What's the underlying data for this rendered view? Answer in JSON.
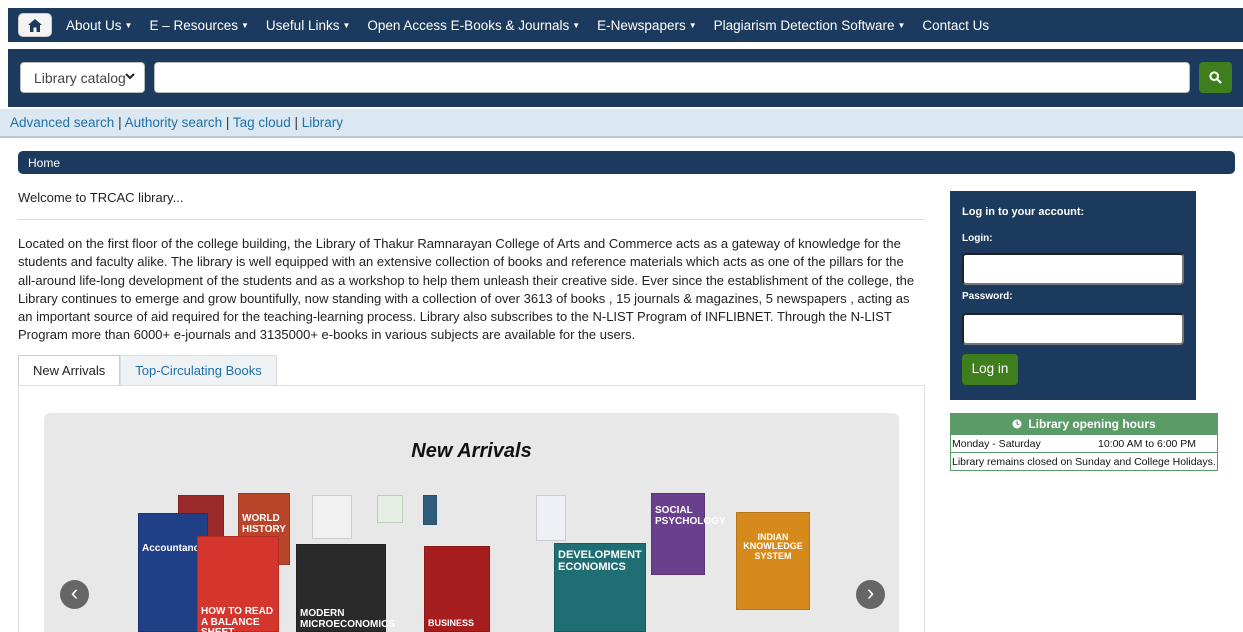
{
  "nav": {
    "items": [
      {
        "label": "About Us",
        "dropdown": true
      },
      {
        "label": "E – Resources",
        "dropdown": true
      },
      {
        "label": "Useful Links",
        "dropdown": true
      },
      {
        "label": "Open Access E-Books & Journals",
        "dropdown": true
      },
      {
        "label": "E-Newspapers",
        "dropdown": true
      },
      {
        "label": "Plagiarism Detection Software",
        "dropdown": true
      },
      {
        "label": "Contact Us",
        "dropdown": false
      }
    ]
  },
  "search": {
    "scope": "Library catalog",
    "value": "",
    "placeholder": ""
  },
  "moresearches": {
    "advanced": "Advanced search",
    "authority": "Authority search",
    "tagcloud": "Tag cloud",
    "library": "Library",
    "sep": " | "
  },
  "breadcrumb": {
    "home": "Home"
  },
  "welcome": "Welcome to TRCAC library...",
  "intro": "Located on the first floor of the college building, the Library of Thakur Ramnarayan College of Arts and Commerce acts as a gateway of knowledge for the students and faculty alike. The library is well equipped with an extensive collection of books and reference materials which acts as one of the pillars for the all-around life-long development of the students and as a workshop to help them unleash their creative side. Ever since the establishment of the college, the Library continues to emerge and grow bountifully, now standing with a collection of over 3613 of books , 15 journals & magazines, 5 newspapers , acting as an important source of aid required for the teaching-learning process. Library also subscribes to the N-LIST Program of INFLIBNET. Through the N-LIST Program more than 6000+ e-journals and 3135000+ e-books in various subjects are available for the users.",
  "tabs": [
    {
      "label": "New Arrivals",
      "active": true
    },
    {
      "label": "Top-Circulating Books",
      "active": false
    }
  ],
  "carousel": {
    "title": "New Arrivals",
    "books": [
      {
        "id": "accountancy",
        "text": "Accountancy",
        "color": "#1f3f86"
      },
      {
        "id": "world-history",
        "text": "WORLD HISTORY",
        "color": "#b8452a"
      },
      {
        "id": "balance-sheet",
        "text": "HOW TO READ A BALANCE SHEET",
        "color": "#d4352c"
      },
      {
        "id": "microeconomics",
        "text": "MODERN MICROECONOMICS",
        "color": "#2a2a2a"
      },
      {
        "id": "business",
        "text": "BUSINESS",
        "color": "#a61d1d"
      },
      {
        "id": "development-economics",
        "text": "DEVELOPMENT ECONOMICS",
        "color": "#1f6e73"
      },
      {
        "id": "social-psychology",
        "text": "SOCIAL PSYCHOLOGY",
        "color": "#6a3f8e"
      },
      {
        "id": "indian-knowledge",
        "text": "INDIAN KNOWLEDGE SYSTEM",
        "color": "#d58a1b"
      }
    ]
  },
  "login": {
    "title": "Log in to your account:",
    "login_label": "Login:",
    "password_label": "Password:",
    "button": "Log in"
  },
  "hours": {
    "title": "Library opening hours",
    "rows": [
      {
        "day": "Monday - Saturday",
        "time": "10:00 AM to 6:00 PM"
      }
    ],
    "note": "Library remains closed on Sunday and College Holidays."
  },
  "colors": {
    "navy": "#1c3a5e",
    "green": "#3f7e1d",
    "hours_green": "#5b9b67",
    "link": "#1f6fa8"
  }
}
